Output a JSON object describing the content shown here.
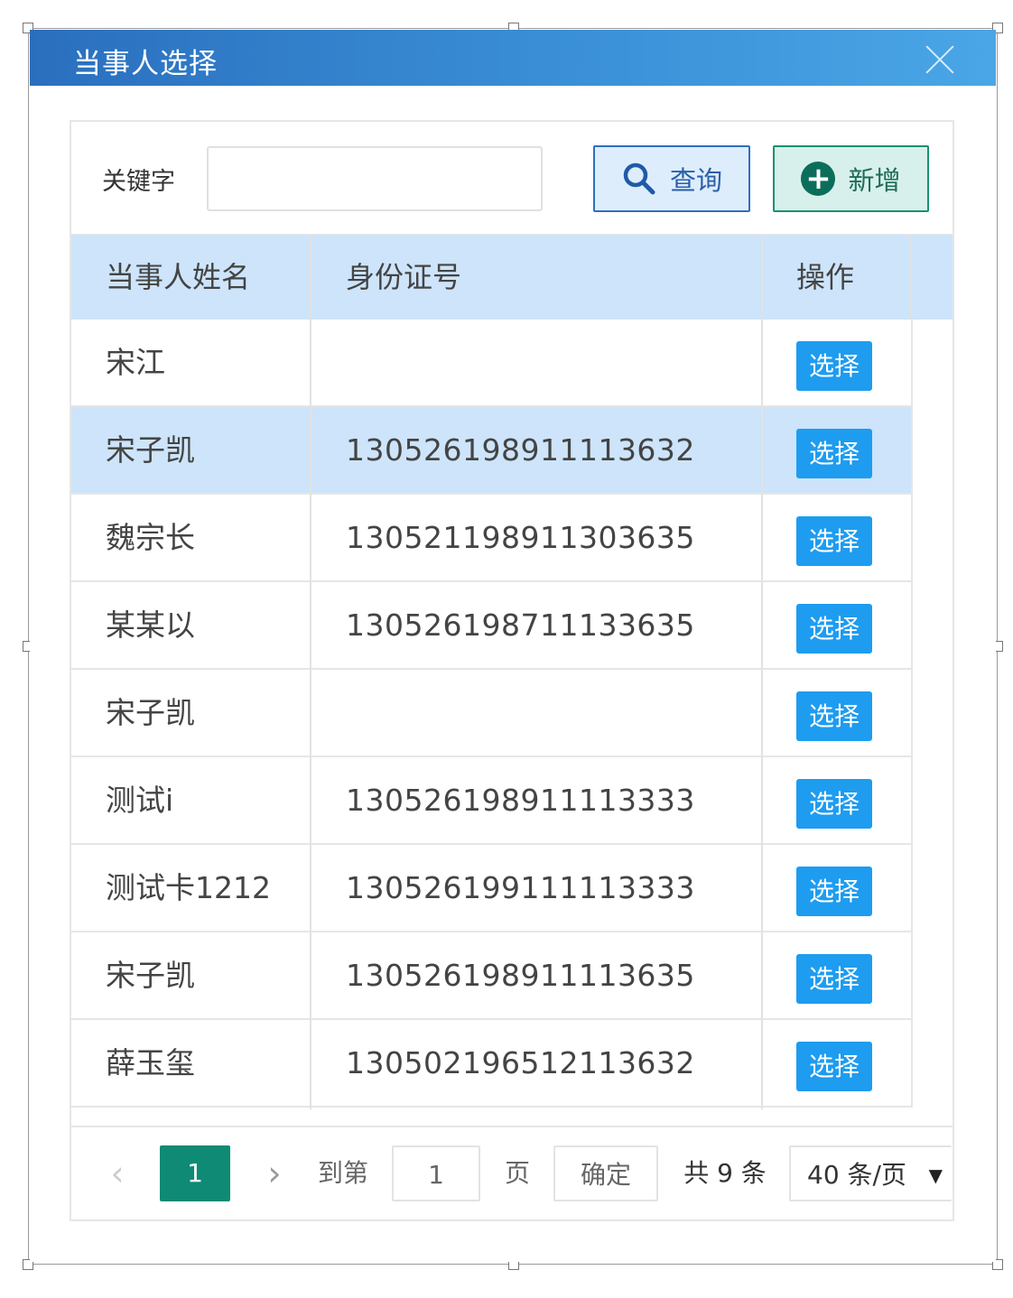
{
  "dialog": {
    "title": "当事人选择",
    "close_icon": "close-icon"
  },
  "search": {
    "keyword_label": "关键字",
    "keyword_value": "",
    "query_button": "查询",
    "query_icon": "search-icon",
    "add_button": "新增",
    "add_icon": "plus-circle-icon"
  },
  "table": {
    "columns": [
      "当事人姓名",
      "身份证号",
      "操作"
    ],
    "highlighted_row": 1,
    "rows": [
      {
        "name": "宋江",
        "id": "",
        "action": "选择"
      },
      {
        "name": "宋子凯",
        "id": "130526198911113632",
        "action": "选择"
      },
      {
        "name": "魏宗长",
        "id": "130521198911303635",
        "action": "选择"
      },
      {
        "name": "某某以",
        "id": "130526198711133635",
        "action": "选择"
      },
      {
        "name": "宋子凯",
        "id": "",
        "action": "选择"
      },
      {
        "name": "测试i",
        "id": "130526198911113333",
        "action": "选择"
      },
      {
        "name": "测试卡1212",
        "id": "130526199111113333",
        "action": "选择"
      },
      {
        "name": "宋子凯",
        "id": "130526198911113635",
        "action": "选择"
      },
      {
        "name": "薛玉玺",
        "id": "130502196512113632",
        "action": "选择"
      }
    ]
  },
  "pagination": {
    "prev": "‹",
    "current_page": "1",
    "next": "›",
    "goto_label": "到第",
    "page_input": "1",
    "page_label": "页",
    "confirm": "确定",
    "total": "共 9 条",
    "page_size": "40 条/页",
    "caret": "▼"
  },
  "colors": {
    "title_bar": "#2a6fbe",
    "header_bg": "#cde4fa",
    "select_button": "#1e9cf0",
    "current_page": "#0f8a74"
  }
}
